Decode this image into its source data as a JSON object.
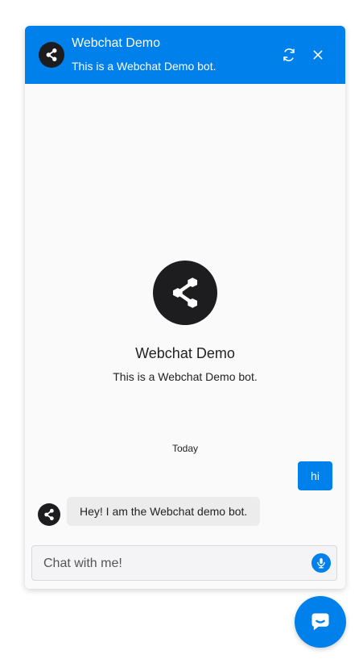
{
  "header": {
    "title": "Webchat Demo",
    "subtitle": "This is a Webchat Demo bot.",
    "avatar_icon": "share-nodes-icon",
    "refresh_icon": "refresh-icon",
    "close_icon": "close-icon"
  },
  "intro": {
    "title": "Webchat Demo",
    "subtitle": "This is a Webchat Demo bot.",
    "avatar_icon": "share-nodes-icon"
  },
  "conversation": {
    "date_separator": "Today",
    "messages": [
      {
        "sender": "user",
        "text": "hi"
      },
      {
        "sender": "bot",
        "text": "Hey! I am the Webchat demo bot."
      }
    ]
  },
  "input": {
    "placeholder": "Chat with me!",
    "value": "",
    "mic_icon": "microphone-icon"
  },
  "launcher": {
    "icon": "chat-bubble-icon"
  },
  "colors": {
    "accent": "#0080ea",
    "avatar_bg": "#1d1d1f",
    "bot_bubble": "#ececec",
    "panel_bg": "#fafafb"
  }
}
